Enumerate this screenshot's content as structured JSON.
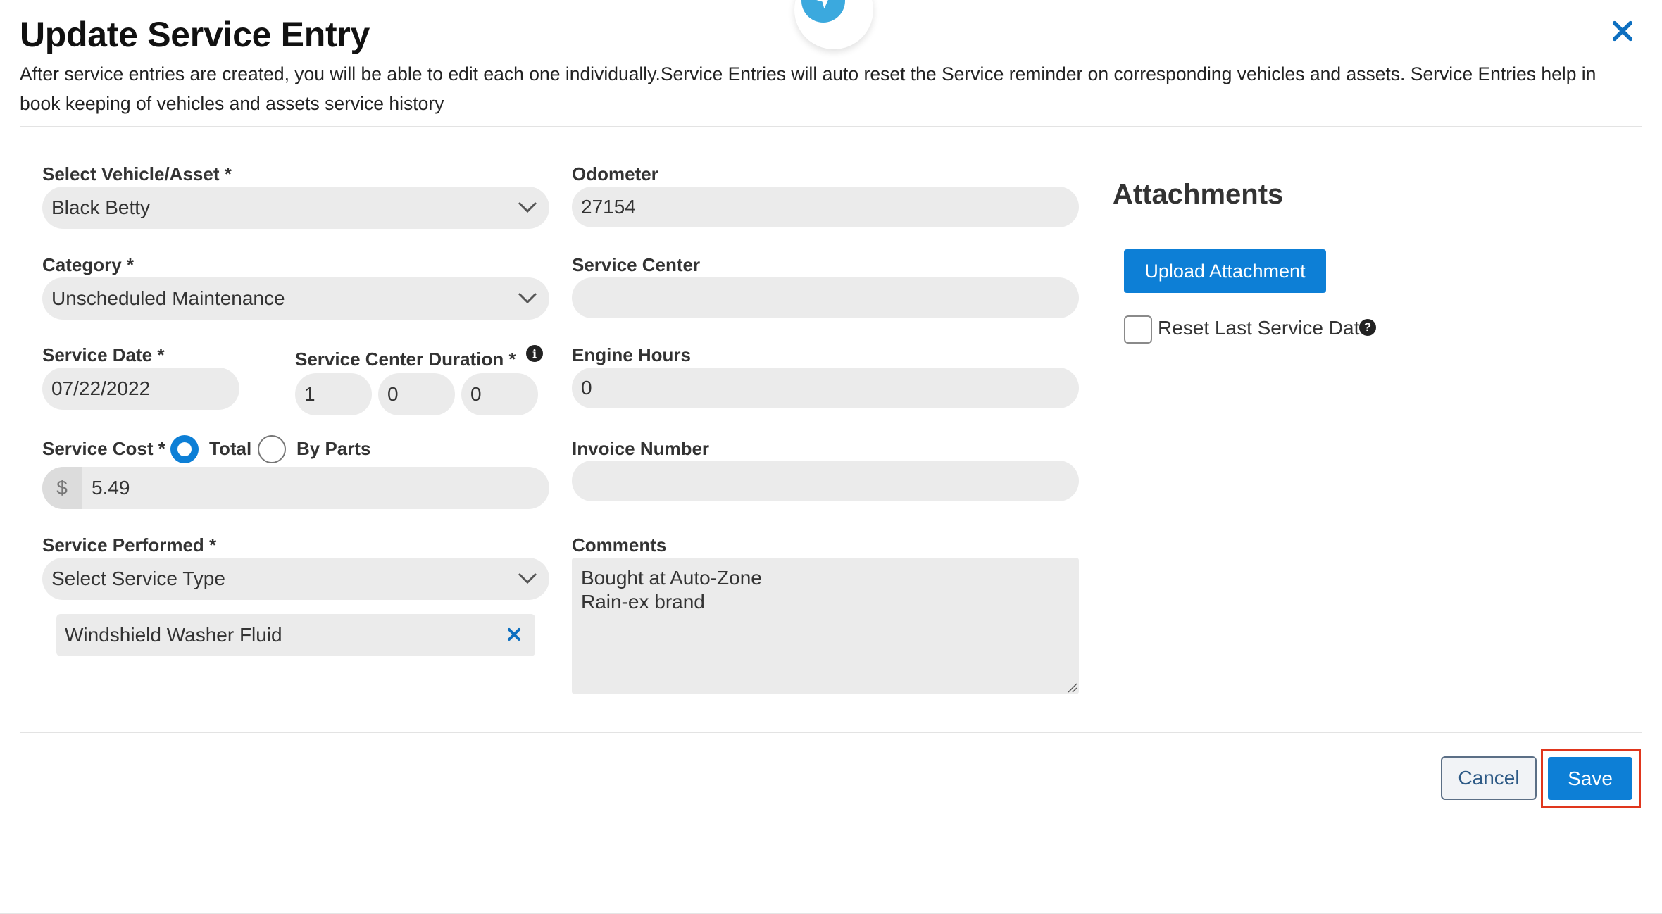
{
  "modal": {
    "title": "Update Service Entry",
    "description": "After service entries are created, you will be able to edit each one individually.Service Entries will auto reset the Service reminder on corresponding vehicles and assets. Service Entries help in book keeping of vehicles and assets service history",
    "close_icon": "close-icon"
  },
  "form": {
    "vehicle": {
      "label": "Select Vehicle/Asset *",
      "value": "Black Betty"
    },
    "category": {
      "label": "Category *",
      "value": "Unscheduled Maintenance"
    },
    "service_date": {
      "label": "Service Date *",
      "value": "07/22/2022"
    },
    "duration": {
      "label": "Service Center Duration *",
      "values": [
        "1",
        "0",
        "0"
      ],
      "info_icon": "info-icon"
    },
    "service_cost": {
      "label": "Service Cost *",
      "options": [
        {
          "label": "Total",
          "selected": true
        },
        {
          "label": "By Parts",
          "selected": false
        }
      ],
      "currency": "$",
      "value": "5.49"
    },
    "service_performed": {
      "label": "Service Performed *",
      "placeholder": "Select Service Type",
      "selected_items": [
        "Windshield Washer Fluid"
      ]
    },
    "odometer": {
      "label": "Odometer",
      "value": "27154"
    },
    "service_center": {
      "label": "Service Center",
      "value": ""
    },
    "engine_hours": {
      "label": "Engine Hours",
      "value": "0"
    },
    "invoice_number": {
      "label": "Invoice Number",
      "value": ""
    },
    "comments": {
      "label": "Comments",
      "value": "Bought at Auto-Zone\nRain-ex brand"
    }
  },
  "attachments": {
    "title": "Attachments",
    "upload_label": "Upload Attachment",
    "reset_label": "Reset Last Service Date",
    "reset_checked": false,
    "help_icon": "help-icon"
  },
  "footer": {
    "cancel_label": "Cancel",
    "save_label": "Save"
  },
  "colors": {
    "primary": "#0d7fd6",
    "highlight": "#e0361d",
    "field_bg": "#ebebeb",
    "top_icon": "#3ba9de"
  }
}
